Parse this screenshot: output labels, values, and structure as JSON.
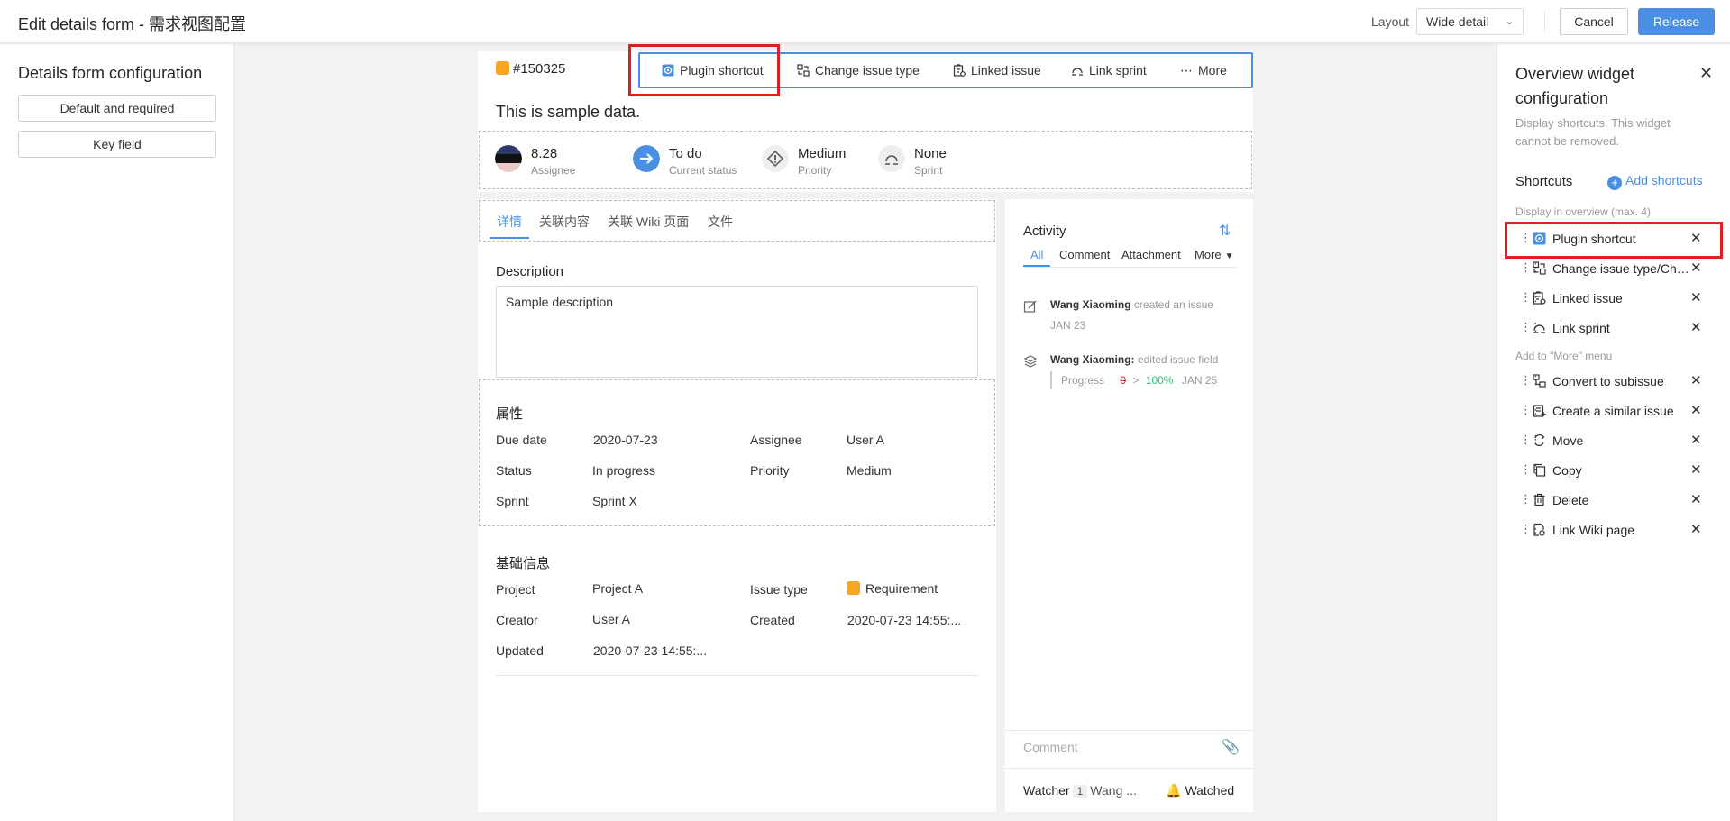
{
  "topbar": {
    "title": "Edit details form - 需求视图配置",
    "layout_label": "Layout",
    "layout_value": "Wide detail",
    "cancel_label": "Cancel",
    "release_label": "Release"
  },
  "left": {
    "title": "Details form configuration",
    "buttons": [
      "Default and required",
      "Key field"
    ]
  },
  "issue": {
    "id": "#150325",
    "title": "This is sample data.",
    "toolbar": [
      "Plugin shortcut",
      "Change issue type",
      "Linked issue",
      "Link sprint",
      "More"
    ],
    "meta": [
      {
        "value": "8.28",
        "label": "Assignee"
      },
      {
        "value": "To do",
        "label": "Current status"
      },
      {
        "value": "Medium",
        "label": "Priority"
      },
      {
        "value": "None",
        "label": "Sprint"
      }
    ]
  },
  "tabs": [
    "详情",
    "关联内容",
    "关联 Wiki 页面",
    "文件"
  ],
  "description": {
    "heading": "Description",
    "text": "Sample description"
  },
  "attributes": {
    "heading": "属性",
    "fields": [
      {
        "label": "Due date",
        "value": "2020-07-23"
      },
      {
        "label": "Assignee",
        "value": "User A"
      },
      {
        "label": "Status",
        "value": "In progress"
      },
      {
        "label": "Priority",
        "value": "Medium"
      },
      {
        "label": "Sprint",
        "value": "Sprint X"
      }
    ]
  },
  "basic": {
    "heading": "基础信息",
    "fields": [
      {
        "label": "Project",
        "value": "Project A"
      },
      {
        "label": "Issue type",
        "value": "Requirement"
      },
      {
        "label": "Creator",
        "value": "User A"
      },
      {
        "label": "Created",
        "value": "2020-07-23 14:55:..."
      },
      {
        "label": "Updated",
        "value": "2020-07-23 14:55:..."
      }
    ]
  },
  "activity": {
    "title": "Activity",
    "tabs": [
      "All",
      "Comment",
      "Attachment",
      "More"
    ],
    "items": [
      {
        "user": "Wang Xiaoming",
        "action": "created an issue",
        "date": "JAN 23"
      },
      {
        "user": "Wang Xiaoming:",
        "action": "edited issue field",
        "field": "Progress",
        "old": "0",
        "new": "100%",
        "date": "JAN 25"
      }
    ],
    "comment_placeholder": "Comment",
    "watcher_label": "Watcher",
    "watcher_count": "1",
    "watcher_name": "Wang ...",
    "watched_label": "Watched"
  },
  "right": {
    "title": "Overview widget configuration",
    "desc": "Display shortcuts. This widget cannot be removed.",
    "shortcuts_heading": "Shortcuts",
    "add_label": "Add shortcuts",
    "overview_note": "Display in overview (max. 4)",
    "overview_items": [
      "Plugin shortcut",
      "Change issue type/Change issue type",
      "Linked issue",
      "Link sprint"
    ],
    "more_note": "Add to \"More\" menu",
    "more_items": [
      "Convert to subissue",
      "Create a similar issue",
      "Move",
      "Copy",
      "Delete",
      "Link Wiki page"
    ]
  },
  "colors": {
    "accent": "#4a90e2",
    "highlight": "#e02020",
    "requirement": "#f5a623",
    "success": "#2fbf71"
  }
}
